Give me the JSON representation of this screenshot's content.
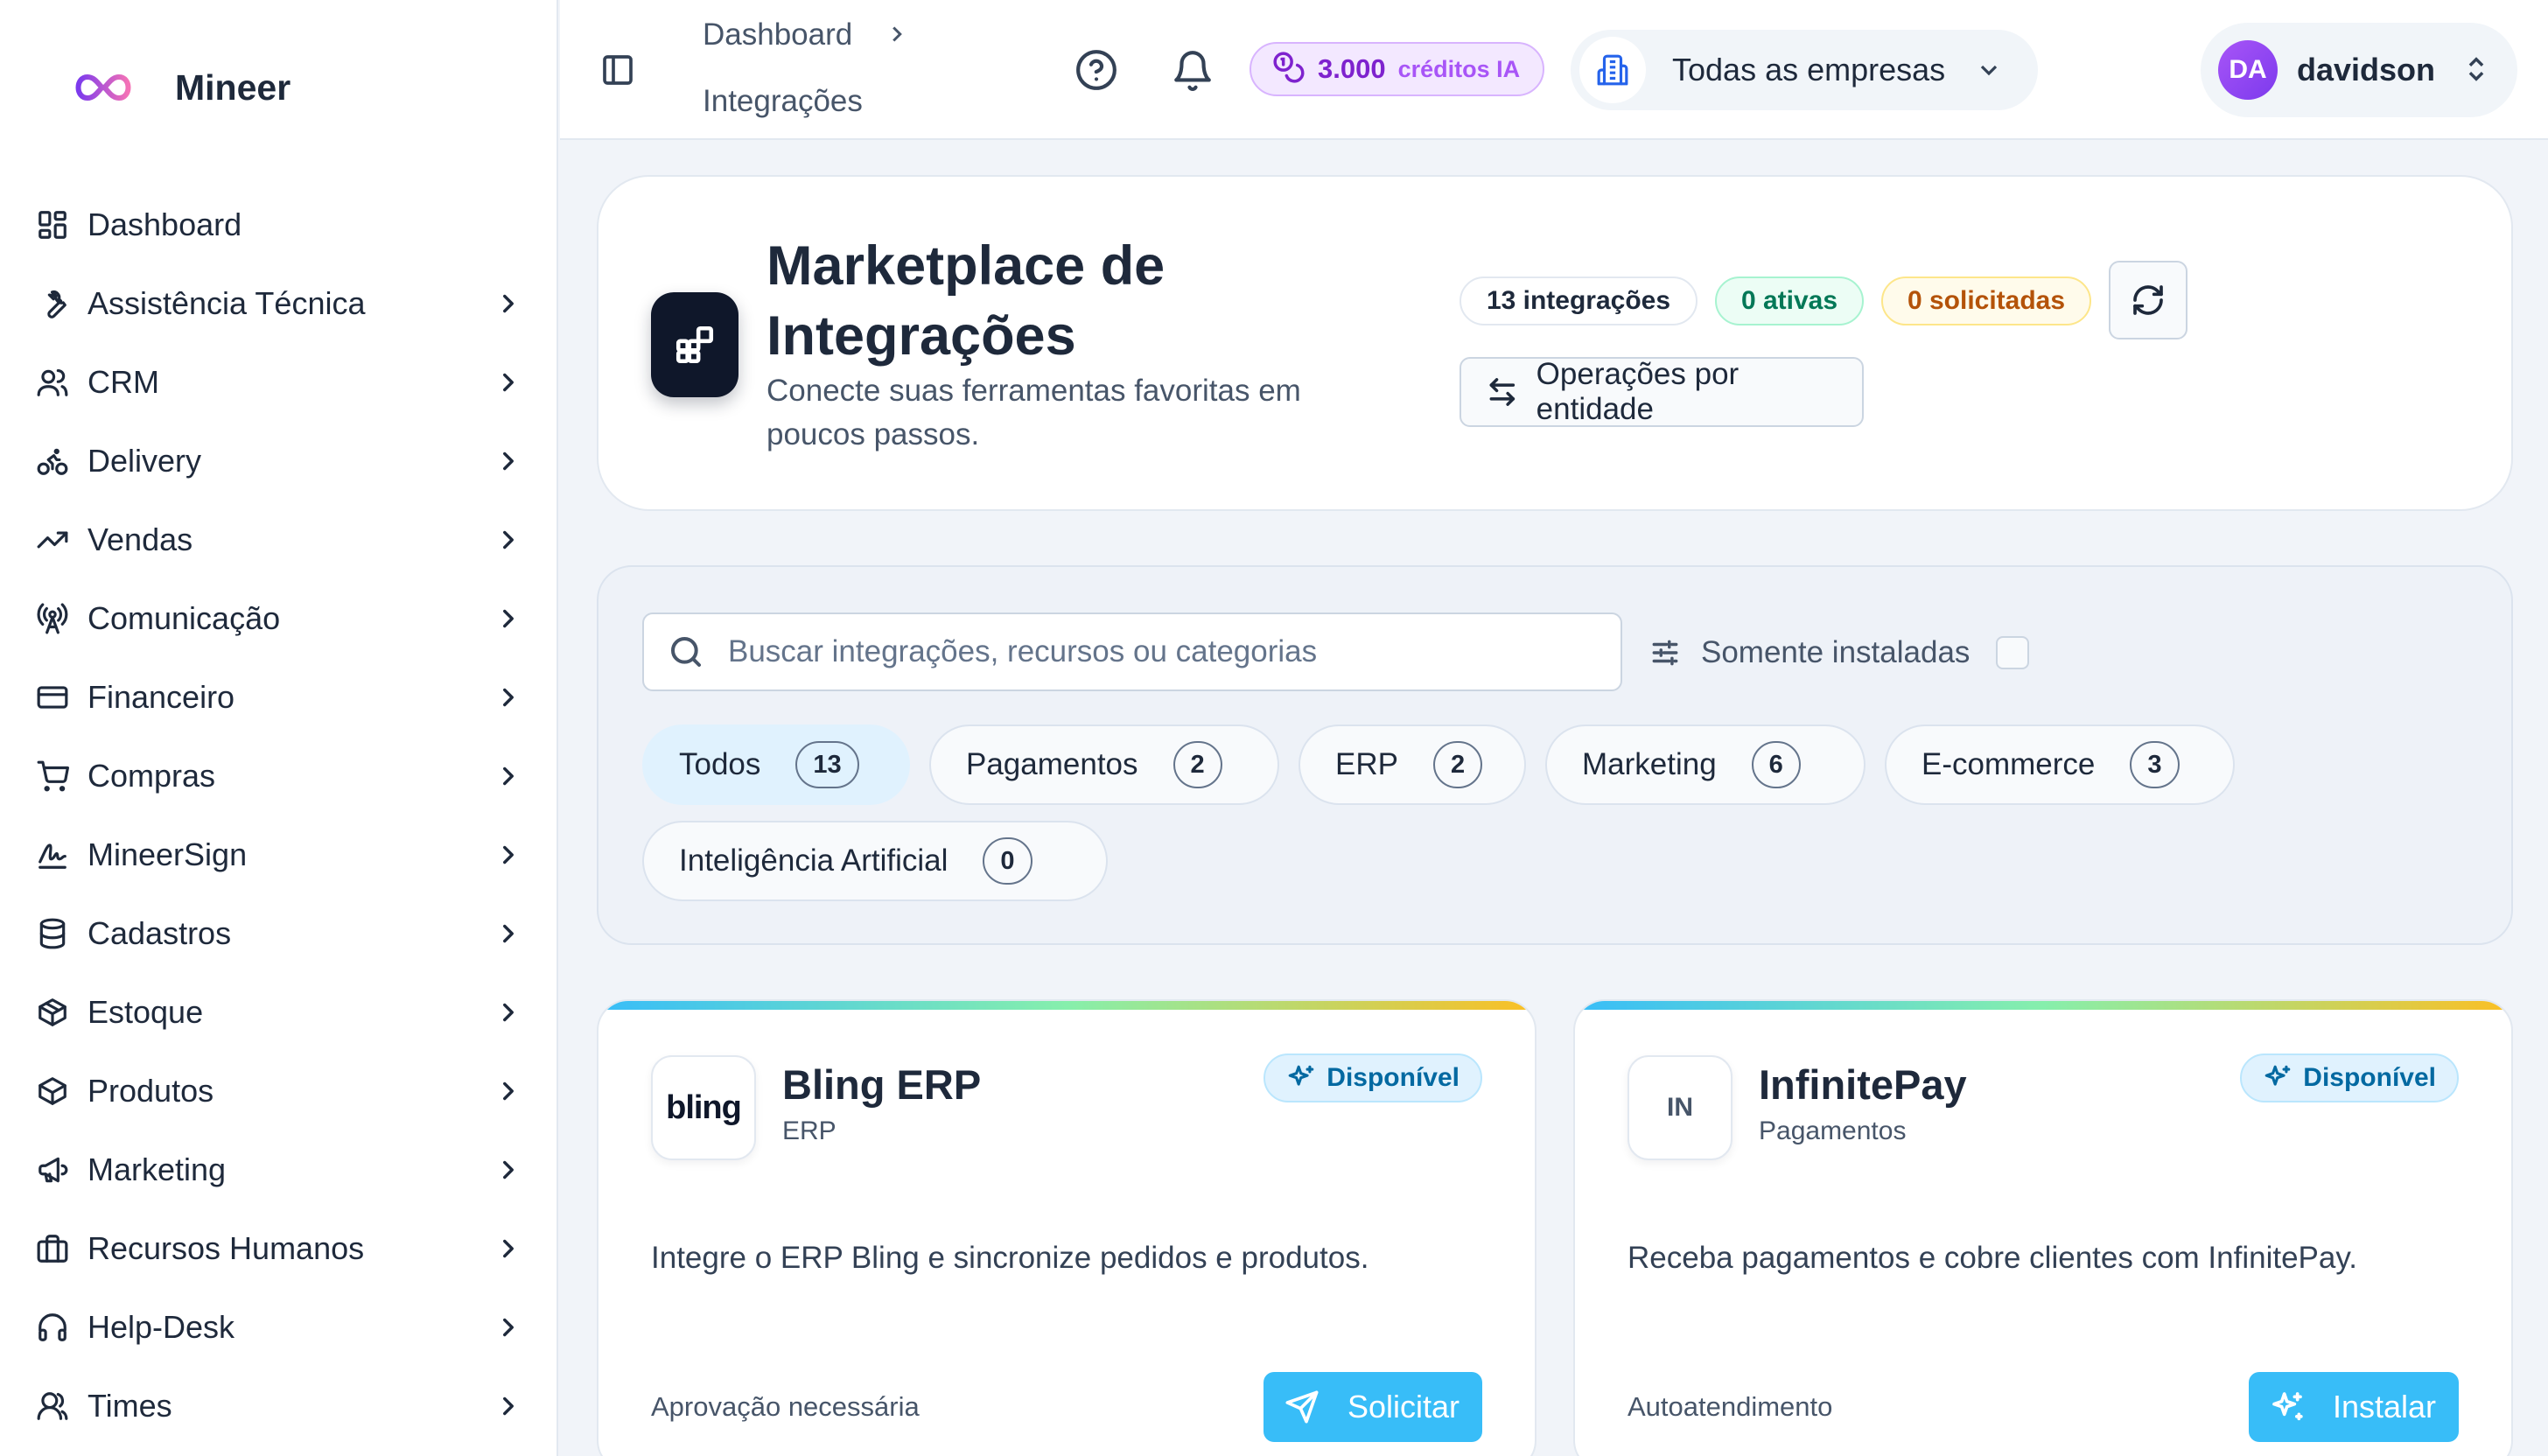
{
  "brand": {
    "name": "Mineer",
    "logo_icon": "infinity-logo"
  },
  "sidebar": {
    "items": [
      {
        "label": "Dashboard",
        "icon": "layout-dashboard-icon",
        "has_children": false
      },
      {
        "label": "Assistência Técnica",
        "icon": "wrench-icon",
        "has_children": true
      },
      {
        "label": "CRM",
        "icon": "users-icon",
        "has_children": true
      },
      {
        "label": "Delivery",
        "icon": "bike-icon",
        "has_children": true
      },
      {
        "label": "Vendas",
        "icon": "trending-up-icon",
        "has_children": true
      },
      {
        "label": "Comunicação",
        "icon": "radio-tower-icon",
        "has_children": true
      },
      {
        "label": "Financeiro",
        "icon": "credit-card-icon",
        "has_children": true
      },
      {
        "label": "Compras",
        "icon": "shopping-cart-icon",
        "has_children": true
      },
      {
        "label": "MineerSign",
        "icon": "signature-icon",
        "has_children": true
      },
      {
        "label": "Cadastros",
        "icon": "database-icon",
        "has_children": true
      },
      {
        "label": "Estoque",
        "icon": "package-icon",
        "has_children": true
      },
      {
        "label": "Produtos",
        "icon": "box-icon",
        "has_children": true
      },
      {
        "label": "Marketing",
        "icon": "megaphone-icon",
        "has_children": true
      },
      {
        "label": "Recursos Humanos",
        "icon": "briefcase-icon",
        "has_children": true
      },
      {
        "label": "Help-Desk",
        "icon": "headphones-icon",
        "has_children": true
      },
      {
        "label": "Times",
        "icon": "user-team-icon",
        "has_children": true
      }
    ]
  },
  "topbar": {
    "breadcrumb": [
      "Dashboard",
      "Integrações"
    ],
    "credits_value": "3.000",
    "credits_label": "créditos IA",
    "company_selector": "Todas as empresas",
    "user_initials": "DA",
    "user_name": "davidson"
  },
  "header": {
    "title": "Marketplace de Integrações",
    "subtitle": "Conecte suas ferramentas favoritas em poucos passos.",
    "total_pill": "13 integrações",
    "active_pill": "0 ativas",
    "requested_pill": "0 solicitadas",
    "operations_button": "Operações por entidade"
  },
  "filters": {
    "search_placeholder": "Buscar integrações, recursos ou categorias",
    "search_value": "",
    "installed_only_label": "Somente instaladas",
    "installed_only_checked": false,
    "categories": [
      {
        "label": "Todos",
        "count": "13",
        "active": true
      },
      {
        "label": "Pagamentos",
        "count": "2",
        "active": false
      },
      {
        "label": "ERP",
        "count": "2",
        "active": false
      },
      {
        "label": "Marketing",
        "count": "6",
        "active": false
      },
      {
        "label": "E-commerce",
        "count": "3",
        "active": false
      },
      {
        "label": "Inteligência Artificial",
        "count": "0",
        "active": false
      }
    ]
  },
  "integrations": [
    {
      "logo_text": "bling",
      "name": "Bling ERP",
      "category": "ERP",
      "status": "Disponível",
      "description": "Integre o ERP Bling e sincronize pedidos e produtos.",
      "note": "Aprovação necessária",
      "action": "Solicitar",
      "action_icon": "send-icon"
    },
    {
      "logo_text": "IN",
      "name": "InfinitePay",
      "category": "Pagamentos",
      "status": "Disponível",
      "description": "Receba pagamentos e cobre clientes com InfinitePay.",
      "note": "Autoatendimento",
      "action": "Instalar",
      "action_icon": "sparkles-icon"
    }
  ],
  "colors": {
    "accent": "#38bdf8",
    "sidebar_bg": "#ffffff",
    "page_bg": "#f1f4f9",
    "credits_purple": "#7e22ce",
    "avatar_purple": "#8b5cf6"
  }
}
